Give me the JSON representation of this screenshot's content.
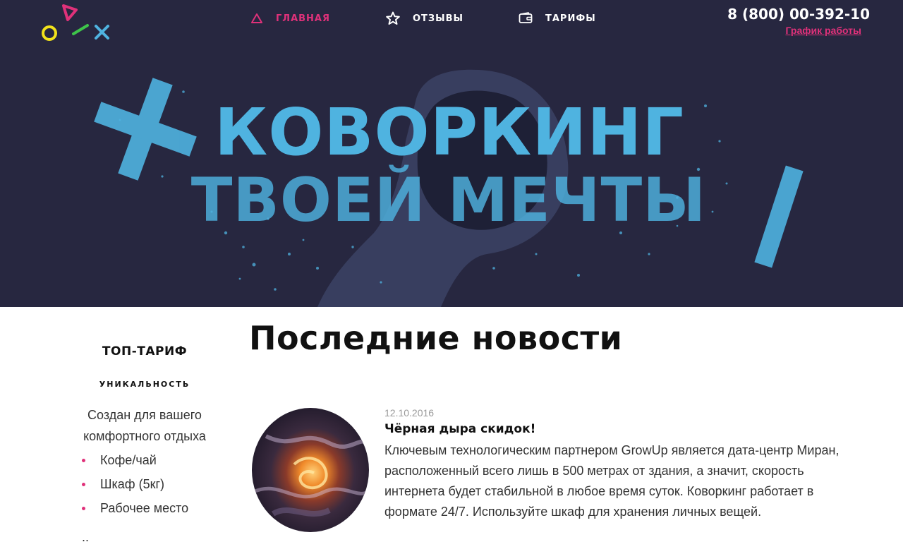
{
  "header": {
    "nav": [
      {
        "label": "ГЛАВНАЯ",
        "icon": "triangle-icon",
        "active": true
      },
      {
        "label": "ОТЗЫВЫ",
        "icon": "star-icon",
        "active": false
      },
      {
        "label": "ТАРИФЫ",
        "icon": "wallet-icon",
        "active": false
      }
    ],
    "phone": "8 (800) 00-392-10",
    "schedule_link": "График работы"
  },
  "hero": {
    "title_line1": "КОВОРКИНГ",
    "title_line2": "ТВОЕЙ МЕЧТЫ"
  },
  "sidebar": {
    "title": "ТОП-ТАРИФ",
    "subtitle": "УНИКАЛЬНОСТЬ",
    "description": "Создан для вашего комфортного отдыха",
    "items": [
      "Кофе/чай",
      "Шкаф (5кг)",
      "Рабочее место"
    ],
    "more": ".."
  },
  "main": {
    "title": "Последние новости",
    "news": [
      {
        "date": "12.10.2016",
        "title": "Чёрная дыра скидок!",
        "text": "Ключевым технологическим партнером GrowUp является дата-центр Миран, расположенный всего лишь в 500 метрах от здания, а значит, скорость интернета будет стабильной в любое время суток. Коворкинг работает в формате 24/7. Используйте шкаф для хранения личных вещей."
      }
    ]
  },
  "colors": {
    "hero_bg": "#272740",
    "accent_pink": "#e0317a",
    "accent_blue": "#4fb3e0",
    "logo_yellow": "#f2e21b",
    "logo_green": "#3ec44a"
  }
}
